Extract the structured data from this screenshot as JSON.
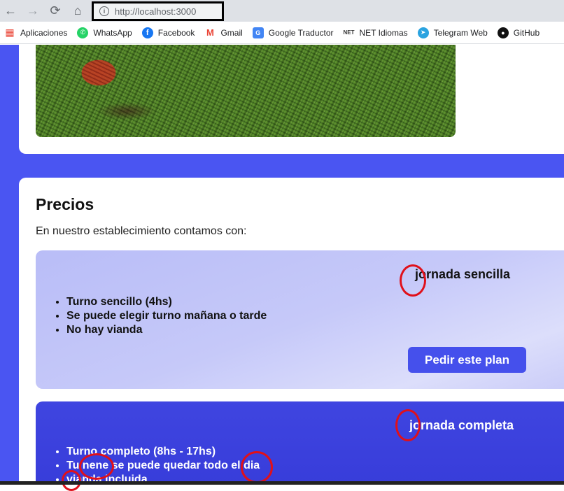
{
  "browser": {
    "url": "http://localhost:3000",
    "bookmarks": [
      {
        "label": "Aplicaciones",
        "icon": "apps-grid-icon",
        "color": "#ea4335"
      },
      {
        "label": "WhatsApp",
        "icon": "whatsapp-icon",
        "color": "#25d366"
      },
      {
        "label": "Facebook",
        "icon": "facebook-icon",
        "color": "#1877f2"
      },
      {
        "label": "Gmail",
        "icon": "gmail-icon",
        "color": "#ea4335"
      },
      {
        "label": "Google Traductor",
        "icon": "google-translate-icon",
        "color": "#4285f4"
      },
      {
        "label": "NET Idiomas",
        "icon": "net-idiomas-icon",
        "color": "#333333"
      },
      {
        "label": "Telegram Web",
        "icon": "telegram-icon",
        "color": "#2aa3e0"
      },
      {
        "label": "GitHub",
        "icon": "github-icon",
        "color": "#111111"
      }
    ]
  },
  "page": {
    "accent": "#4a55f2",
    "prices": {
      "title": "Precios",
      "intro": "En nuestro establecimiento contamos con:",
      "plans": [
        {
          "name": "jornada sencilla",
          "items": [
            "Turno sencillo (4hs)",
            "Se puede elegir turno mañana o tarde",
            "No hay vianda"
          ],
          "button": "Pedir este plan"
        },
        {
          "name": "jornada completa",
          "items": [
            "Turno completo (8hs - 17hs)",
            "Tu nene se puede quedar todo el dia",
            "vianda incluida"
          ]
        }
      ]
    }
  }
}
